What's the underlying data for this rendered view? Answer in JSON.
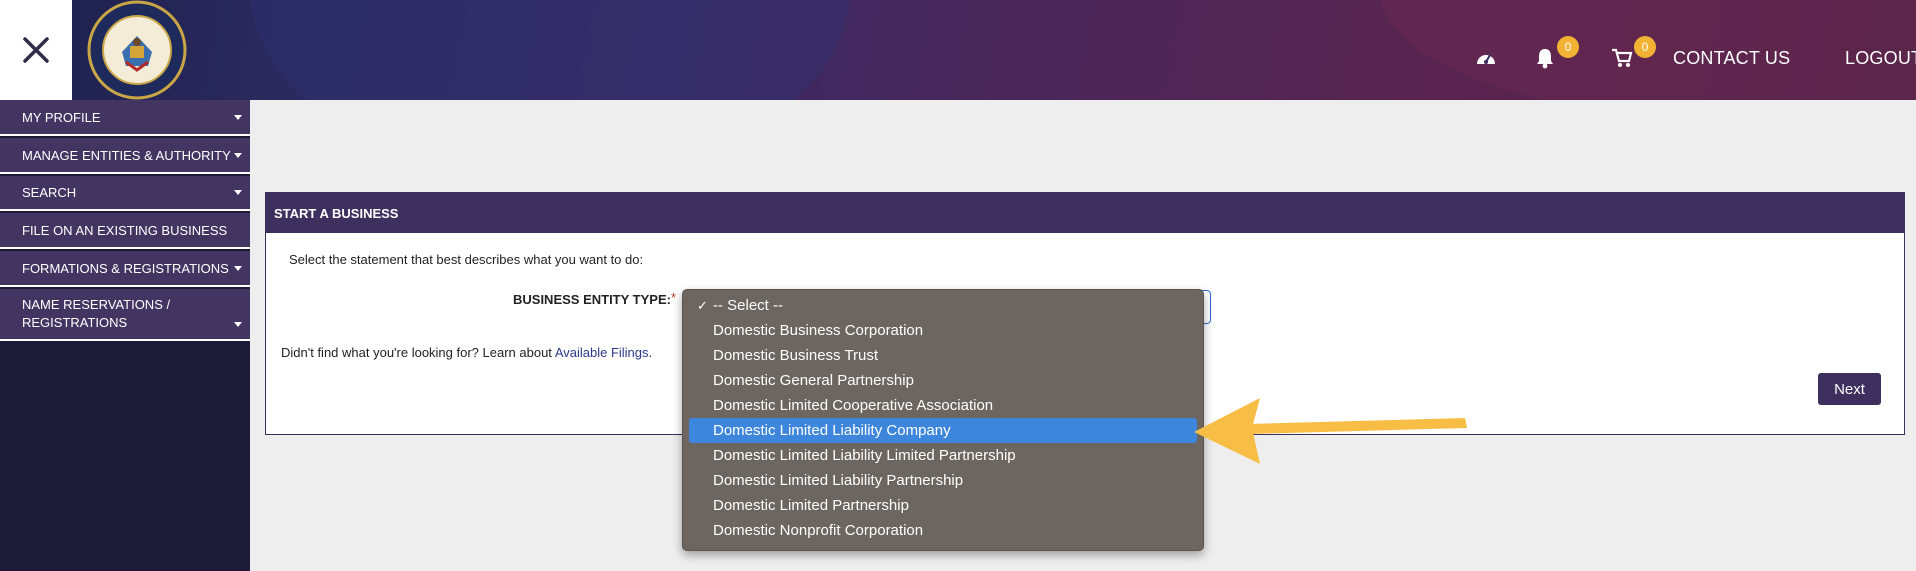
{
  "header": {
    "seal_alt": "THE GREAT SEAL OF THE STATE OF UTAH 1896",
    "notifications_count": "0",
    "cart_count": "0",
    "contact_label": "CONTACT US",
    "logout_label": "LOGOUT"
  },
  "sidebar": {
    "items": [
      {
        "label": "MY PROFILE"
      },
      {
        "label": "MANAGE ENTITIES & AUTHORITY"
      },
      {
        "label": "SEARCH"
      },
      {
        "label": "FILE ON AN EXISTING BUSINESS"
      },
      {
        "label": "FORMATIONS & REGISTRATIONS"
      },
      {
        "label": "NAME RESERVATIONS / REGISTRATIONS"
      }
    ]
  },
  "panel": {
    "title": "START A BUSINESS",
    "instruction": "Select the statement that best describes what you want to do:",
    "field_label": "BUSINESS ENTITY TYPE:",
    "required_mark": "*",
    "help_prefix": "Didn't find what you're looking for? Learn about ",
    "help_link": "Available Filings",
    "help_suffix": ".",
    "next_label": "Next"
  },
  "dropdown": {
    "check": "✓",
    "options": [
      "-- Select --",
      "Domestic Business Corporation",
      "Domestic Business Trust",
      "Domestic General Partnership",
      "Domestic Limited Cooperative Association",
      "Domestic Limited Liability Company",
      "Domestic Limited Liability Limited Partnership",
      "Domestic Limited Liability Partnership",
      "Domestic Limited Partnership",
      "Domestic Nonprofit Corporation"
    ],
    "highlighted": "Domestic Limited Liability Company"
  },
  "colors": {
    "brand_purple": "#3d2f5e",
    "highlight_blue": "#3d86db",
    "badge_yellow": "#f2b233",
    "arrow_yellow": "#f7bd45"
  }
}
